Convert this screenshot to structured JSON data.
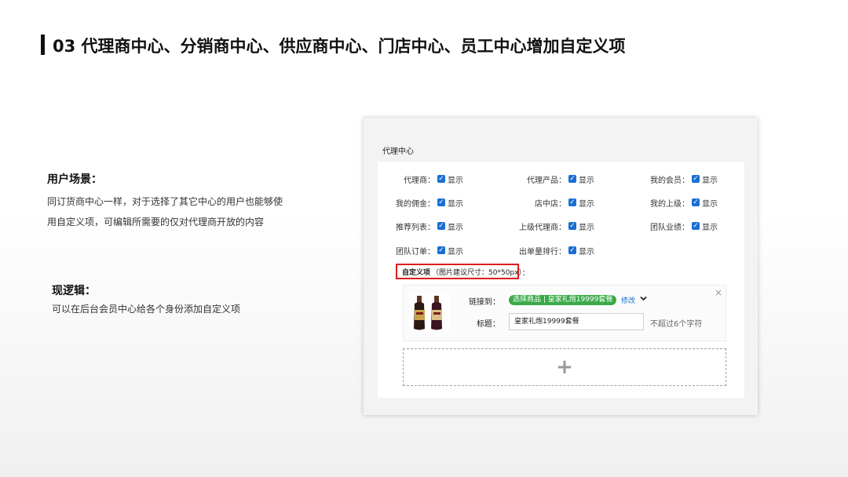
{
  "slide": {
    "title": "03 代理商中心、分销商中心、供应商中心、门店中心、员工中心增加自定义项",
    "scene_title": "用户场景：",
    "scene_text": "同订货商中心一样，对于选择了其它中心的用户也能够使用自定义项，可编辑所需要的仅对代理商开放的内容",
    "logic_title": "现逻辑：",
    "logic_text": "可以在后台会员中心给各个身份添加自定义项"
  },
  "panel": {
    "title": "代理中心",
    "options": [
      {
        "label": "代理商：",
        "value": "显示",
        "checked": true
      },
      {
        "label": "代理产品：",
        "value": "显示",
        "checked": true
      },
      {
        "label": "我的会员：",
        "value": "显示",
        "checked": true
      },
      {
        "label": "我的佣金：",
        "value": "显示",
        "checked": true
      },
      {
        "label": "店中店：",
        "value": "显示",
        "checked": true
      },
      {
        "label": "我的上级：",
        "value": "显示",
        "checked": true
      },
      {
        "label": "推荐列表：",
        "value": "显示",
        "checked": true
      },
      {
        "label": "上级代理商：",
        "value": "显示",
        "checked": true
      },
      {
        "label": "团队业绩：",
        "value": "显示",
        "checked": true
      },
      {
        "label": "团队订单：",
        "value": "显示",
        "checked": true
      },
      {
        "label": "出单量排行：",
        "value": "显示",
        "checked": true
      }
    ],
    "custom": {
      "label": "自定义项",
      "size_hint": "（图片建议尺寸：50*50px）",
      "colon": "：",
      "link_label": "链接到：",
      "link_tag": "选择商品 | 皇家礼炮19999套餐",
      "modify": "修改",
      "title_label": "标题：",
      "title_value": "皇家礼炮19999套餐",
      "title_hint": "不超过6个字符",
      "close": "×",
      "add": "+"
    }
  }
}
